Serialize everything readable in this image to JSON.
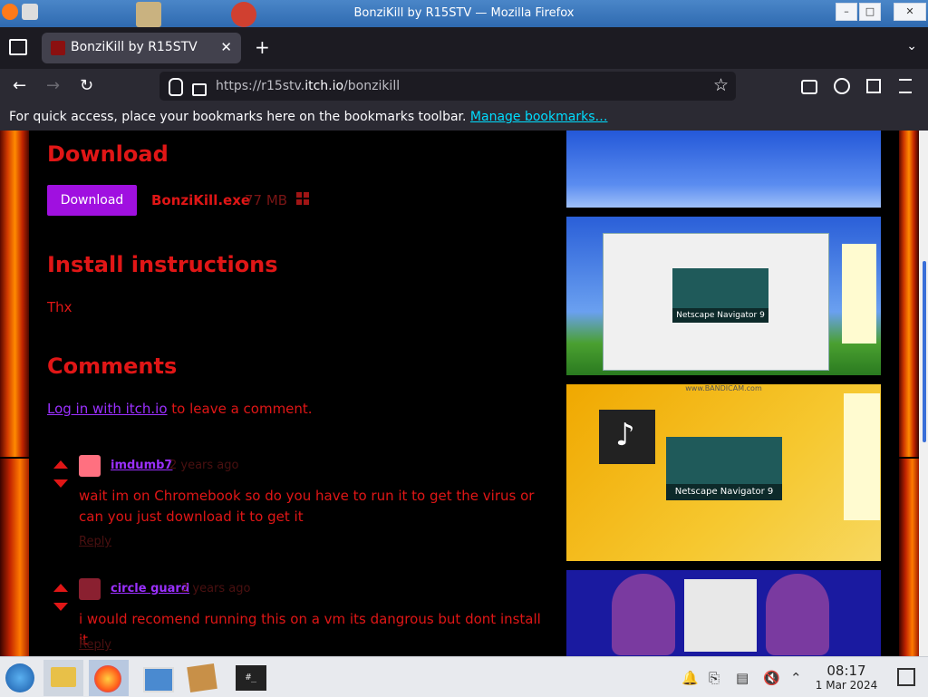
{
  "window": {
    "title": "BonziKill by R15STV — Mozilla Firefox",
    "minimize": "–",
    "maximize": "□",
    "close": "✕"
  },
  "tabs": [
    {
      "label": "BonziKill by R15STV",
      "close": "✕"
    }
  ],
  "newtab": "+",
  "tabmenu": "⌄",
  "nav": {
    "back": "←",
    "forward": "→",
    "reload": "↻",
    "url_prefix": "https://r15stv.",
    "url_host": "itch.io",
    "url_path": "/bonzikill",
    "bookmark_star": "☆"
  },
  "bookmarks": {
    "message": "For quick access, place your bookmarks here on the bookmarks toolbar.",
    "link": "Manage bookmarks…"
  },
  "page": {
    "download_heading": "Download",
    "download_button": "Download",
    "file_name": "BonziKill.exe",
    "file_size": "77 MB",
    "install_heading": "Install instructions",
    "install_text": "Thx",
    "comments_heading": "Comments",
    "login_link": "Log in with itch.io",
    "login_suffix": " to leave a comment.",
    "comments": [
      {
        "user": "imdumb7",
        "date": "2 years ago",
        "body": "wait im on Chromebook so do you have to run it to get the virus or can you just download it to get it",
        "reply": "Reply"
      },
      {
        "user": "circle guard",
        "date": "2 years ago",
        "body": "i would recomend running this on a vm its dangrous but dont install it",
        "reply": "Reply"
      }
    ],
    "screenshot_labels": {
      "netscape1": "Netscape Navigator 9",
      "netscape2": "Netscape Navigator 9",
      "bandicam": "www.BANDICAM.com"
    }
  },
  "taskbar": {
    "time": "08:17",
    "date": "1 Mar 2024"
  },
  "colors": {
    "accent_red": "#e01616",
    "button_purple": "#a010e0",
    "link_purple": "#9b30ff"
  }
}
